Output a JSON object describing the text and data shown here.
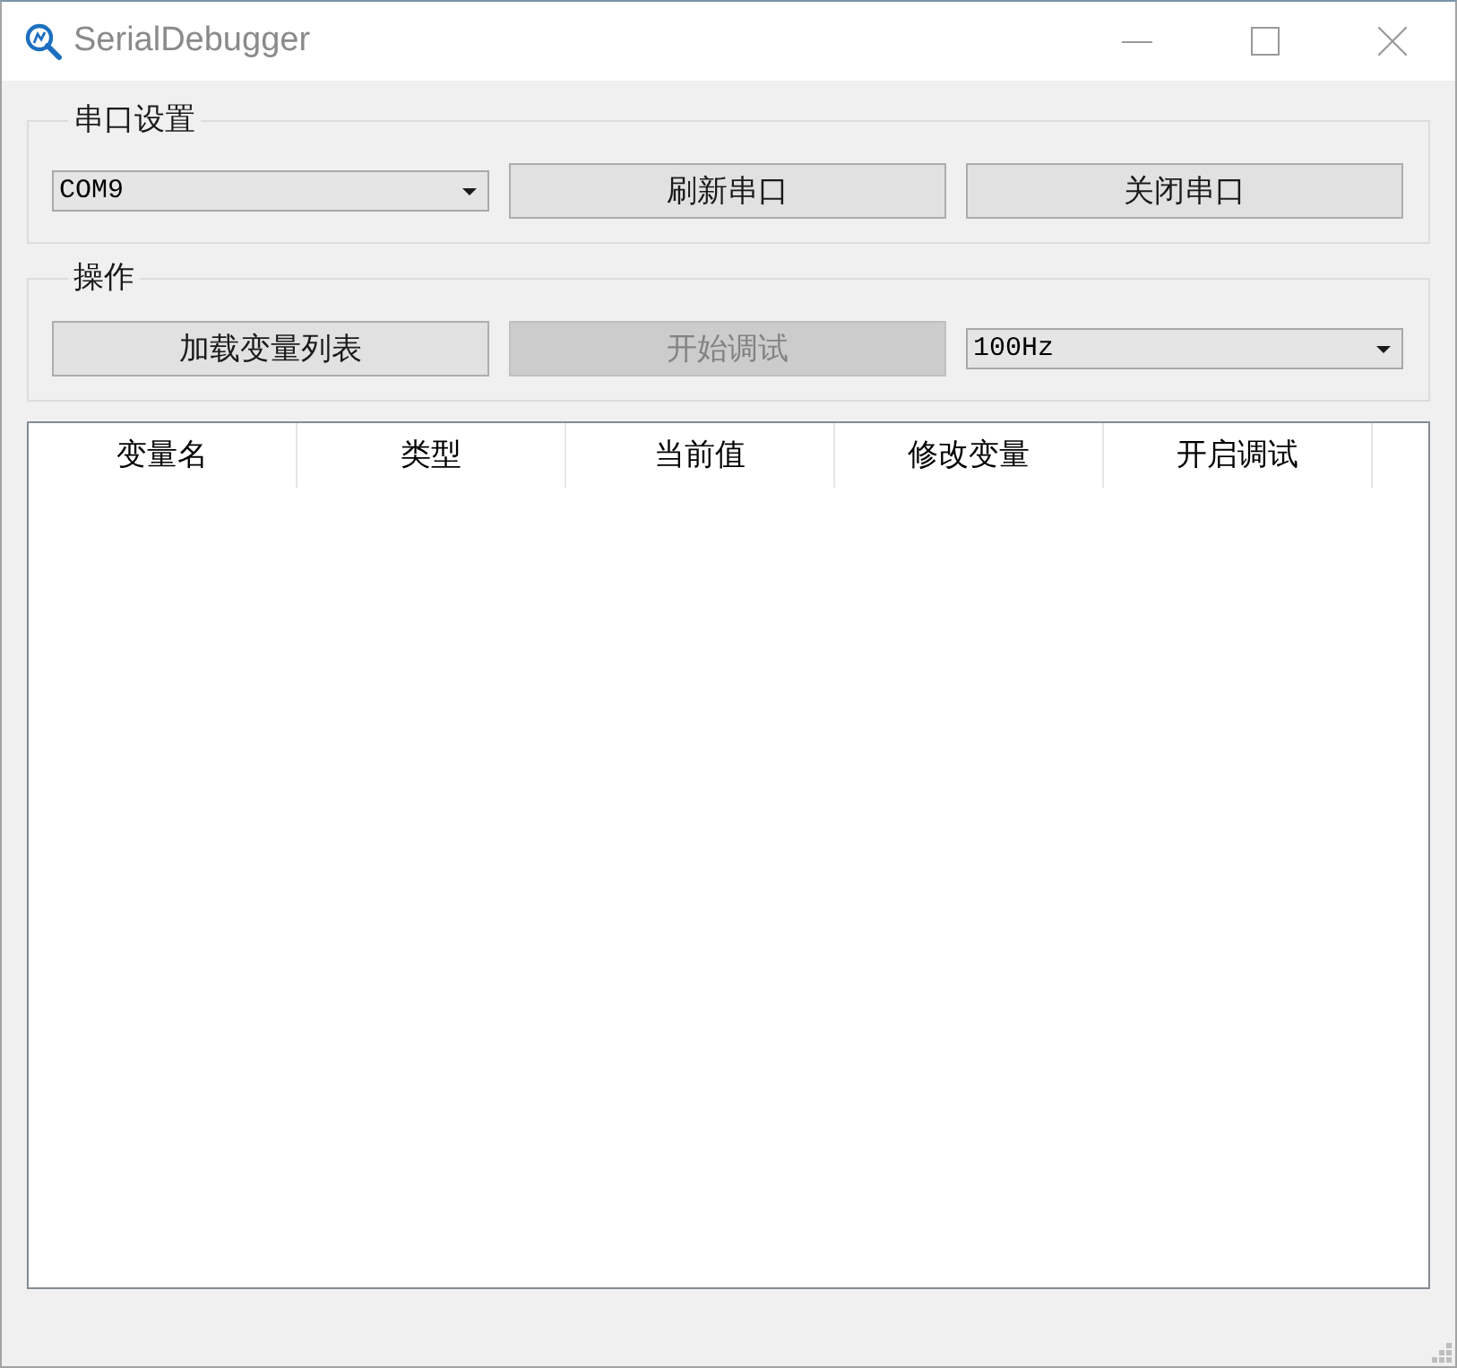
{
  "window": {
    "title": "SerialDebugger"
  },
  "serial_settings": {
    "title": "串口设置",
    "port_select": {
      "value": "COM9"
    },
    "buttons": [
      {
        "label": "刷新串口",
        "disabled": false
      },
      {
        "label": "关闭串口",
        "disabled": false
      }
    ]
  },
  "operations": {
    "title": "操作",
    "buttons": [
      {
        "label": "加载变量列表",
        "disabled": false
      },
      {
        "label": "开始调试",
        "disabled": true
      }
    ],
    "rate_select": {
      "value": "100Hz"
    }
  },
  "table": {
    "columns": [
      "变量名",
      "类型",
      "当前值",
      "修改变量",
      "开启调试"
    ]
  }
}
